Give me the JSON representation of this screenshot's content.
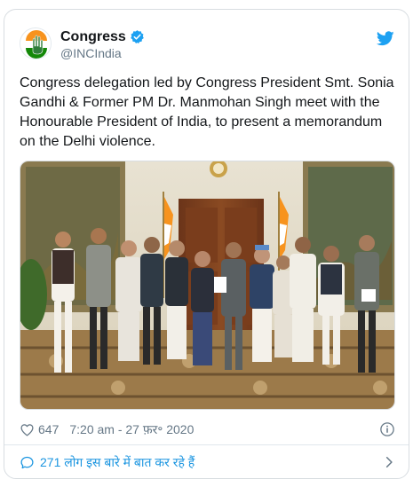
{
  "tweet": {
    "display_name": "Congress",
    "handle": "@INCIndia",
    "text": "Congress delegation led by Congress President Smt. Sonia Gandhi & Former PM Dr. Manmohan Singh meet with the Honourable President of India, to present a memorandum on the Delhi violence.",
    "likes": "647",
    "timestamp": "7:20 am - 27 फ़र॰ 2020",
    "replies_text": "271 लोग इस बारे में बात कर रहे हैं"
  },
  "icons": {
    "avatar": "congress-logo",
    "verified": "verified-badge-icon",
    "brand": "twitter-bird-icon",
    "like": "heart-icon",
    "info": "info-icon",
    "reply": "speech-bubble-icon",
    "more": "chevron-right-icon"
  },
  "colors": {
    "twitter_blue": "#1da1f2",
    "link_blue": "#1b95e0",
    "muted": "#657786",
    "text": "#14171a"
  }
}
